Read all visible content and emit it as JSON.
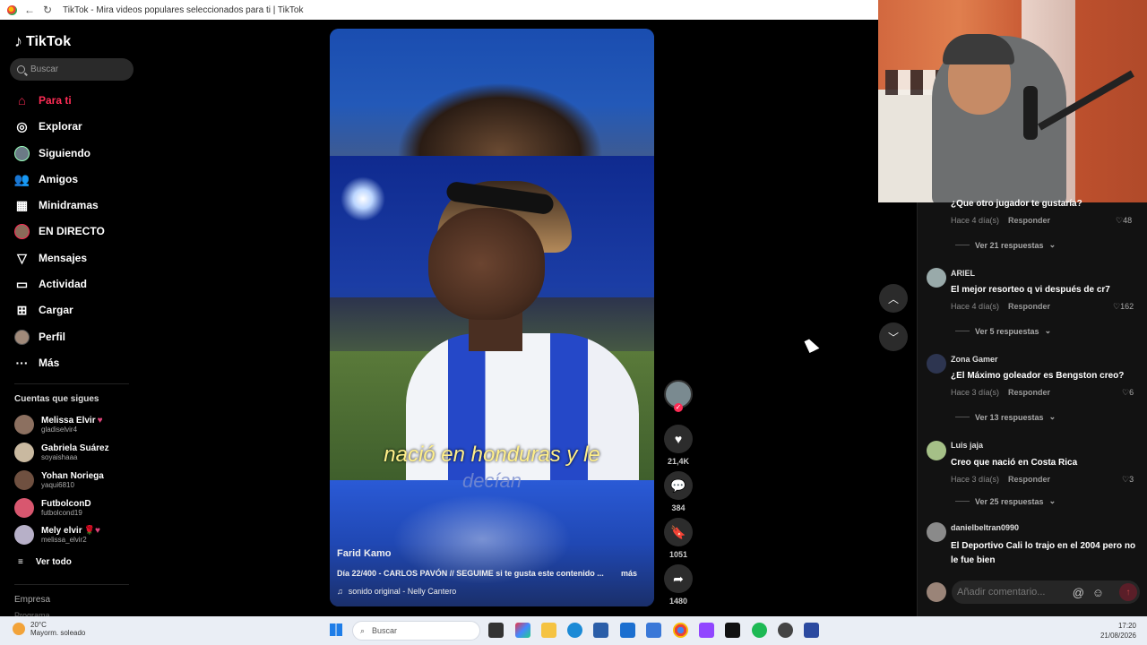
{
  "browser": {
    "title": "TikTok - Mira videos populares seleccionados para ti | TikTok"
  },
  "sidebar": {
    "logo": "TikTok",
    "search_placeholder": "Buscar",
    "nav": [
      {
        "label": "Para ti",
        "icon": "home-icon"
      },
      {
        "label": "Explorar",
        "icon": "compass-icon"
      },
      {
        "label": "Siguiendo",
        "icon": "avatar-icon"
      },
      {
        "label": "Amigos",
        "icon": "people-icon"
      },
      {
        "label": "Minidramas",
        "icon": "film-icon"
      },
      {
        "label": "EN DIRECTO",
        "icon": "live-icon"
      },
      {
        "label": "Mensajes",
        "icon": "send-icon"
      },
      {
        "label": "Actividad",
        "icon": "inbox-icon"
      },
      {
        "label": "Cargar",
        "icon": "plus-square-icon"
      },
      {
        "label": "Perfil",
        "icon": "profile-icon"
      },
      {
        "label": "Más",
        "icon": "more-icon"
      }
    ],
    "following_title": "Cuentas que sigues",
    "following": [
      {
        "name": "Melissa Elvir",
        "handle": "gladiselvir4"
      },
      {
        "name": "Gabriela Suárez",
        "handle": "soyaishaaa"
      },
      {
        "name": "Yohan Noriega",
        "handle": "yaqui6810"
      },
      {
        "name": "FutbolconD",
        "handle": "futbolcond19"
      },
      {
        "name": "Mely elvir",
        "handle": "melissa_elvir2"
      }
    ],
    "see_all": "Ver todo",
    "footer_company": "Empresa",
    "footer_program": "Programa"
  },
  "video": {
    "subtitle_line1": "nació en honduras y le",
    "subtitle_line2": "decían",
    "author": "Farid Kamo",
    "description": "Día 22/400 - CARLOS PAVÓN // SEGUIME si te gusta este contenido ...",
    "more": "más",
    "sound": "sonido original - Nelly Cantero"
  },
  "actions": {
    "likes": "21,4K",
    "comments": "384",
    "saves": "1051",
    "shares": "1480"
  },
  "comments": [
    {
      "name": "",
      "text": "¿Que otro jugador te gustaría?",
      "time": "Hace 4 día(s)",
      "reply": "Responder",
      "likes": "48",
      "replies": "Ver 21 respuestas"
    },
    {
      "name": "ARIEL",
      "text": "El mejor resorteo q vi después de cr7",
      "time": "Hace 4 día(s)",
      "reply": "Responder",
      "likes": "162",
      "replies": "Ver 5 respuestas"
    },
    {
      "name": "Zona Gamer",
      "text": "¿El Máximo goleador es Bengston creo?",
      "time": "Hace 3 día(s)",
      "reply": "Responder",
      "likes": "6",
      "replies": "Ver 13 respuestas"
    },
    {
      "name": "Luis jaja",
      "text": "Creo que nació en Costa Rica",
      "time": "Hace 3 día(s)",
      "reply": "Responder",
      "likes": "3",
      "replies": "Ver 25 respuestas"
    },
    {
      "name": "danielbeltran0990",
      "text": "El Deportivo Cali lo trajo en el 2004 pero no le fue bien",
      "time": "",
      "reply": "",
      "likes": "",
      "replies": ""
    }
  ],
  "add_comment_placeholder": "Añadir comentario...",
  "taskbar": {
    "temp": "20°C",
    "weather": "Mayorm. soleado",
    "search": "Buscar",
    "time": "17:20",
    "date": "21/08/2026"
  },
  "colors": {
    "accent": "#fe2c55",
    "bg": "#000000",
    "panel": "#121212"
  }
}
